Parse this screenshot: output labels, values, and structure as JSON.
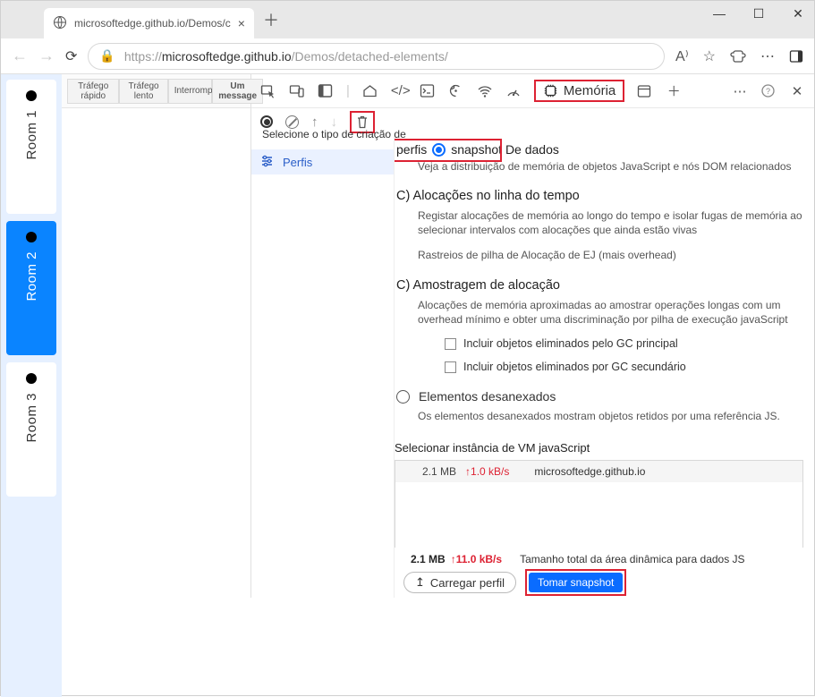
{
  "window": {
    "tab_title": "microsoftedge.github.io/Demos/c",
    "url_prefix": "https://",
    "url_host": "microsoftedge.github.io",
    "url_path": "/Demos/detached-elements/"
  },
  "page": {
    "rooms": [
      "Room 1",
      "Room 2",
      "Room 3"
    ],
    "selected_room_index": 1,
    "toolbar": {
      "fast": "Tráfego\nrápido",
      "slow": "Tráfego\nlento",
      "stop": "Interromper",
      "msg": "Um\nmessage"
    }
  },
  "devtools": {
    "memory_tab": "Memória",
    "sub_caption": "Selecione o tipo de criação de",
    "perfis_label": "Perfis",
    "perfis_word": "perfis",
    "snapshot_title_rest": "snapshot De dados",
    "snapshot_desc": "Veja a distribuição de memória de objetos JavaScript e nós DOM relacionados",
    "alloc_timeline_h": "C) Alocações no linha do tempo",
    "alloc_timeline_d": "Registar alocações de memória ao longo do tempo e isolar fugas de memória ao selecionar intervalos com alocações que ainda estão vivas",
    "alloc_timeline_d2": "Rastreios de pilha de Alocação de EJ (mais overhead)",
    "alloc_sampling_h": "C) Amostragem de alocação",
    "alloc_sampling_d": "Alocações de memória aproximadas ao amostrar operações longas com um overhead mínimo e obter uma discriminação por pilha de execução javaScript",
    "chk_gc_major": "Incluir objetos eliminados pelo GC principal",
    "chk_gc_minor": "Incluir objetos eliminados por GC secundário",
    "detached_h": "Elementos desanexados",
    "detached_d": "Os elementos desanexados mostram objetos retidos por uma referência JS.",
    "vm_head": "Selecionar instância de VM javaScript",
    "vm_row": {
      "mb": "2.1 MB",
      "rate": "↑1.0 kB/s",
      "host": "microsoftedge.github.io"
    },
    "footer": {
      "mb": "2.1 MB",
      "rate": "↑11.0 kB/s",
      "total_label": "Tamanho total da área dinâmica para dados JS",
      "load_label": "Carregar perfil",
      "snapshot_label": "Tomar snapshot"
    }
  }
}
